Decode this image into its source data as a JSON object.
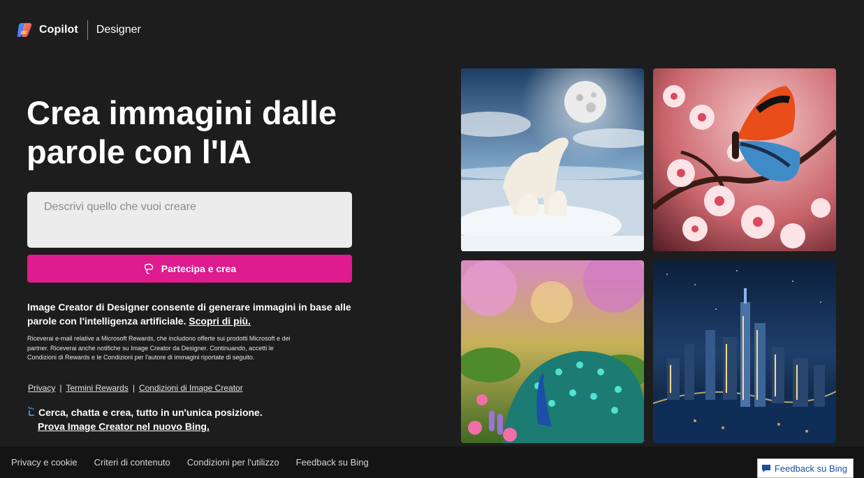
{
  "header": {
    "brand": "Copilot",
    "product": "Designer"
  },
  "hero": {
    "title_line1": "Crea immagini dalle",
    "title_line2": "parole con l'IA"
  },
  "prompt": {
    "placeholder": "Descrivi quello che vuoi creare",
    "value": ""
  },
  "create_button": {
    "label": "Partecipa e crea"
  },
  "intro": {
    "text": "Image Creator di Designer consente di generare immagini in base alle parole con l'intelligenza artificiale.",
    "link": "Scopri di più."
  },
  "fine_print": "Riceverai e-mail relative a Microsoft Rewards, che includono offerte sui prodotti Microsoft e dei partner. Riceverai anche notifiche su Image Creator da Designer. Continuando, accetti le Condizioni di Rewards e le Condizioni per l'autore di immagini riportate di seguito.",
  "legal_links": {
    "privacy": "Privacy",
    "rewards_terms": "Termini Rewards",
    "creator_terms": "Condizioni di Image Creator",
    "separator": "|"
  },
  "promo": {
    "text": "Cerca, chatta e crea, tutto in un'unica posizione.",
    "link": "Prova Image Creator nel nuovo Bing."
  },
  "gallery": [
    {
      "alt": "Orsi polari sotto la luna"
    },
    {
      "alt": "Farfalla su fiori di ciliegio"
    },
    {
      "alt": "Pavone in un giardino fiorito"
    },
    {
      "alt": "Città notturna con grattacieli"
    }
  ],
  "footer": {
    "links": [
      "Privacy e cookie",
      "Criteri di contenuto",
      "Condizioni per l'utilizzo",
      "Feedback su Bing"
    ],
    "feedback_button": "Feedback su Bing"
  },
  "colors": {
    "background": "#1d1d1d",
    "accent": "#de1b8f",
    "footer": "#141414"
  },
  "icons": [
    "copilot-logo-icon",
    "sparkle-icon",
    "magic-icon",
    "feedback-icon"
  ]
}
